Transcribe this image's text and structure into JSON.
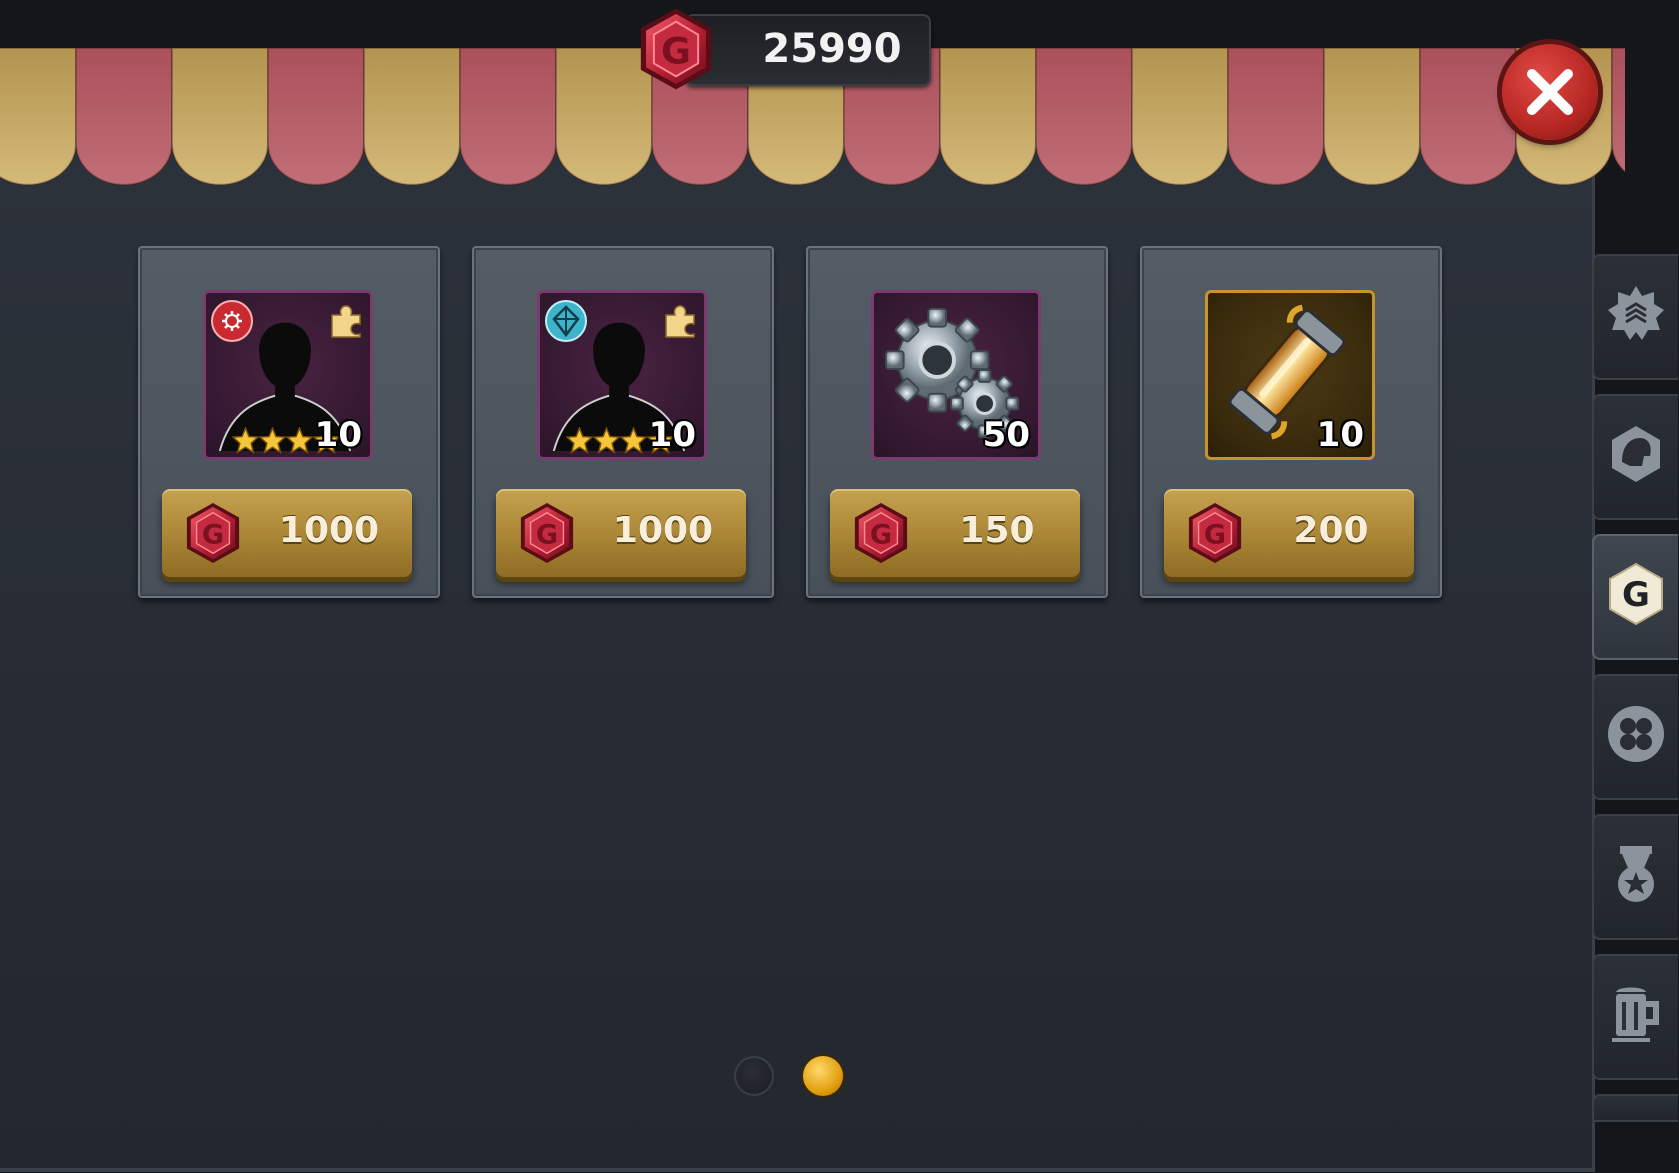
{
  "currency": {
    "amount": "25990",
    "icon": "g-gem-icon",
    "color": "#c0283b"
  },
  "close_icon": "close-icon",
  "items": [
    {
      "name": "hero-fragment-red-faction",
      "quantity": "10",
      "price": "1000",
      "frame": "purple",
      "faction_color": "#d23a3a",
      "stars": 4,
      "icon": "hero-silhouette-icon"
    },
    {
      "name": "hero-fragment-blue-faction",
      "quantity": "10",
      "price": "1000",
      "frame": "purple",
      "faction_color": "#3fb3c9",
      "stars": 4,
      "icon": "hero-silhouette-icon"
    },
    {
      "name": "gears",
      "quantity": "50",
      "price": "150",
      "frame": "purple",
      "icon": "gears-icon"
    },
    {
      "name": "energy-capsule",
      "quantity": "10",
      "price": "200",
      "frame": "gold",
      "icon": "capsule-icon"
    }
  ],
  "pagination": {
    "pages": 2,
    "active": 2
  },
  "side_tabs": [
    {
      "icon": "badge-icon",
      "active": false
    },
    {
      "icon": "helmet-icon",
      "active": false
    },
    {
      "icon": "g-shop-icon",
      "active": true,
      "label": "G"
    },
    {
      "icon": "clover-icon",
      "active": false
    },
    {
      "icon": "medal-icon",
      "active": false
    },
    {
      "icon": "mug-icon",
      "active": false
    }
  ],
  "colors": {
    "awning_red": "#b9616b",
    "awning_gold": "#c9ae6b",
    "button_gold": "#a98535"
  }
}
